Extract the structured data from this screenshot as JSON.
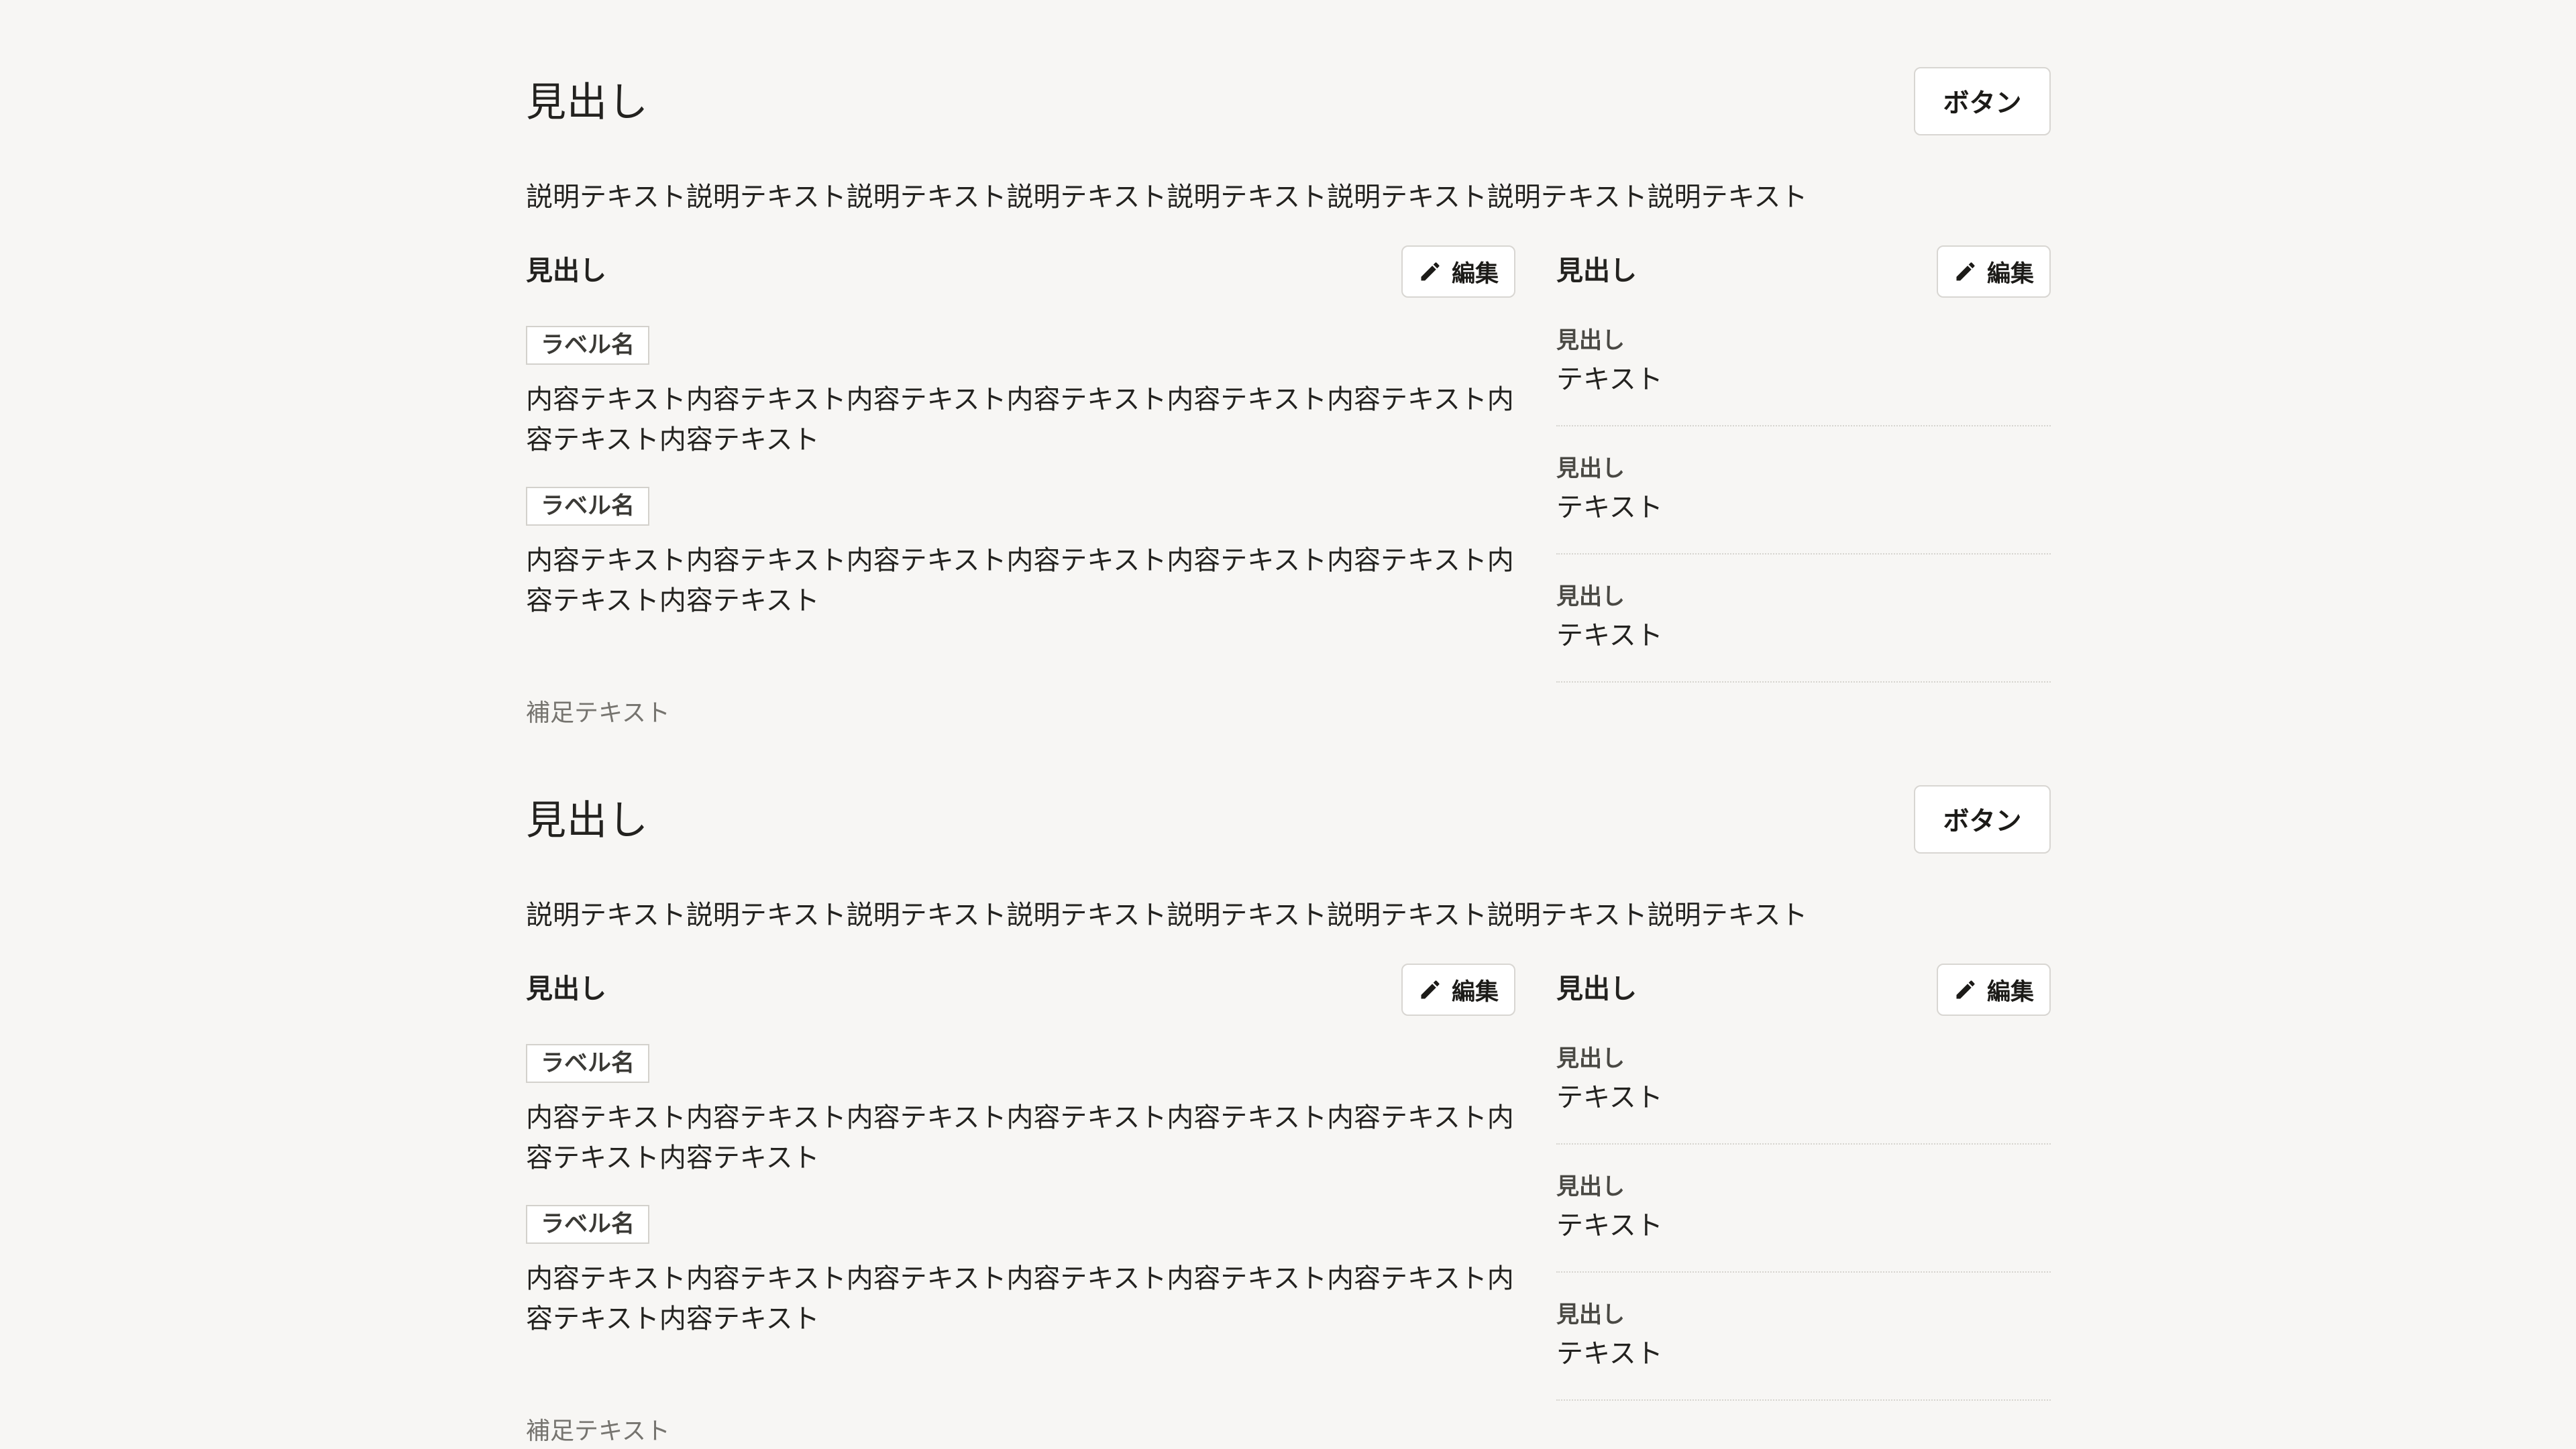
{
  "sections": [
    {
      "title": "見出し",
      "button_label": "ボタン",
      "description": "説明テキスト説明テキスト説明テキスト説明テキスト説明テキスト説明テキスト説明テキスト説明テキスト",
      "left_card": {
        "title": "見出し",
        "edit_label": "編集",
        "items": [
          {
            "label": "ラベル名",
            "content": "内容テキスト内容テキスト内容テキスト内容テキスト内容テキスト内容テキスト内容テキスト内容テキスト"
          },
          {
            "label": "ラベル名",
            "content": "内容テキスト内容テキスト内容テキスト内容テキスト内容テキスト内容テキスト内容テキスト内容テキスト"
          }
        ]
      },
      "right_card": {
        "title": "見出し",
        "edit_label": "編集",
        "rows": [
          {
            "key": "見出し",
            "value": "テキスト"
          },
          {
            "key": "見出し",
            "value": "テキスト"
          },
          {
            "key": "見出し",
            "value": "テキスト"
          }
        ]
      },
      "supplement": "補足テキスト"
    },
    {
      "title": "見出し",
      "button_label": "ボタン",
      "description": "説明テキスト説明テキスト説明テキスト説明テキスト説明テキスト説明テキスト説明テキスト説明テキスト",
      "left_card": {
        "title": "見出し",
        "edit_label": "編集",
        "items": [
          {
            "label": "ラベル名",
            "content": "内容テキスト内容テキスト内容テキスト内容テキスト内容テキスト内容テキスト内容テキスト内容テキスト"
          },
          {
            "label": "ラベル名",
            "content": "内容テキスト内容テキスト内容テキスト内容テキスト内容テキスト内容テキスト内容テキスト内容テキスト"
          }
        ]
      },
      "right_card": {
        "title": "見出し",
        "edit_label": "編集",
        "rows": [
          {
            "key": "見出し",
            "value": "テキスト"
          },
          {
            "key": "見出し",
            "value": "テキスト"
          },
          {
            "key": "見出し",
            "value": "テキスト"
          }
        ]
      },
      "supplement": "補足テキスト"
    }
  ],
  "icons": {
    "edit": "pencil-icon"
  },
  "colors": {
    "background": "#f7f6f4",
    "text": "#23221f",
    "muted": "#76746f",
    "border": "#d8d6d2"
  }
}
